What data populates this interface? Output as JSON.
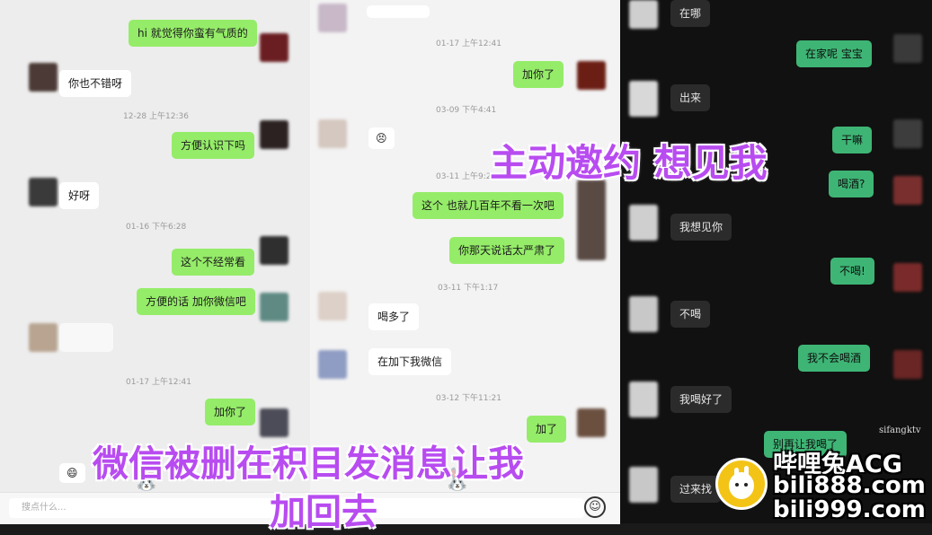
{
  "left_chat": {
    "messages": [
      {
        "text": "hi 就觉得你蛮有气质的",
        "side": "right"
      },
      {
        "text": "你也不错呀",
        "side": "left"
      },
      {
        "text": "方便认识下吗",
        "side": "right"
      },
      {
        "text": "好呀",
        "side": "left"
      },
      {
        "text": "这个不经常看",
        "side": "right"
      },
      {
        "text": "方便的话 加你微信吧",
        "side": "right"
      },
      {
        "text": "加你了",
        "side": "right"
      }
    ],
    "timestamps": [
      "12-28 上午12:36",
      "01-16 下午6:28",
      "01-17 上午12:41"
    ],
    "partial_emoji": "😄"
  },
  "middle_chat": {
    "messages": [
      {
        "text": "加你了",
        "side": "right"
      },
      {
        "text": "😣",
        "side": "left"
      },
      {
        "text": "这个 也就几百年不看一次吧",
        "side": "right"
      },
      {
        "text": "你那天说话太严肃了",
        "side": "right"
      },
      {
        "text": "喝多了",
        "side": "left"
      },
      {
        "text": "在加下我微信",
        "side": "left"
      },
      {
        "text": "加了",
        "side": "right"
      }
    ],
    "timestamps": [
      "01-17 上午12:41",
      "03-09 下午4:41",
      "03-11 上午9:2",
      "03-11 下午1:17",
      "03-12 下午11:21"
    ]
  },
  "right_chat": {
    "messages": [
      {
        "text": "在哪",
        "side": "left"
      },
      {
        "text": "在家呢 宝宝",
        "side": "right"
      },
      {
        "text": "出来",
        "side": "left"
      },
      {
        "text": "干嘛",
        "side": "right"
      },
      {
        "text": "喝酒?",
        "side": "right"
      },
      {
        "text": "我想见你",
        "side": "left"
      },
      {
        "text": "不喝!",
        "side": "right"
      },
      {
        "text": "不喝",
        "side": "left"
      },
      {
        "text": "我不会喝酒",
        "side": "right"
      },
      {
        "text": "我喝好了",
        "side": "left"
      },
      {
        "text": "别再让我喝了",
        "side": "right"
      },
      {
        "text": "过来找",
        "side": "left"
      }
    ],
    "source_tag": "sifangktv"
  },
  "input_bar": {
    "placeholder": "搜点什么...",
    "emoji_icon": "smiley-icon"
  },
  "overlays": {
    "caption_top": "主动邀约 想见我",
    "caption_bottom_line1": "微信被删在积目发消息让我",
    "caption_bottom_line2": "加回去"
  },
  "watermark": {
    "line1": "哔哩兔ACG",
    "line2": "bili888.com",
    "line3": "bili999.com"
  },
  "colors": {
    "accent_purple": "#b84cf0",
    "wechat_green": "#95ec69",
    "dark_green": "#3eb575"
  }
}
